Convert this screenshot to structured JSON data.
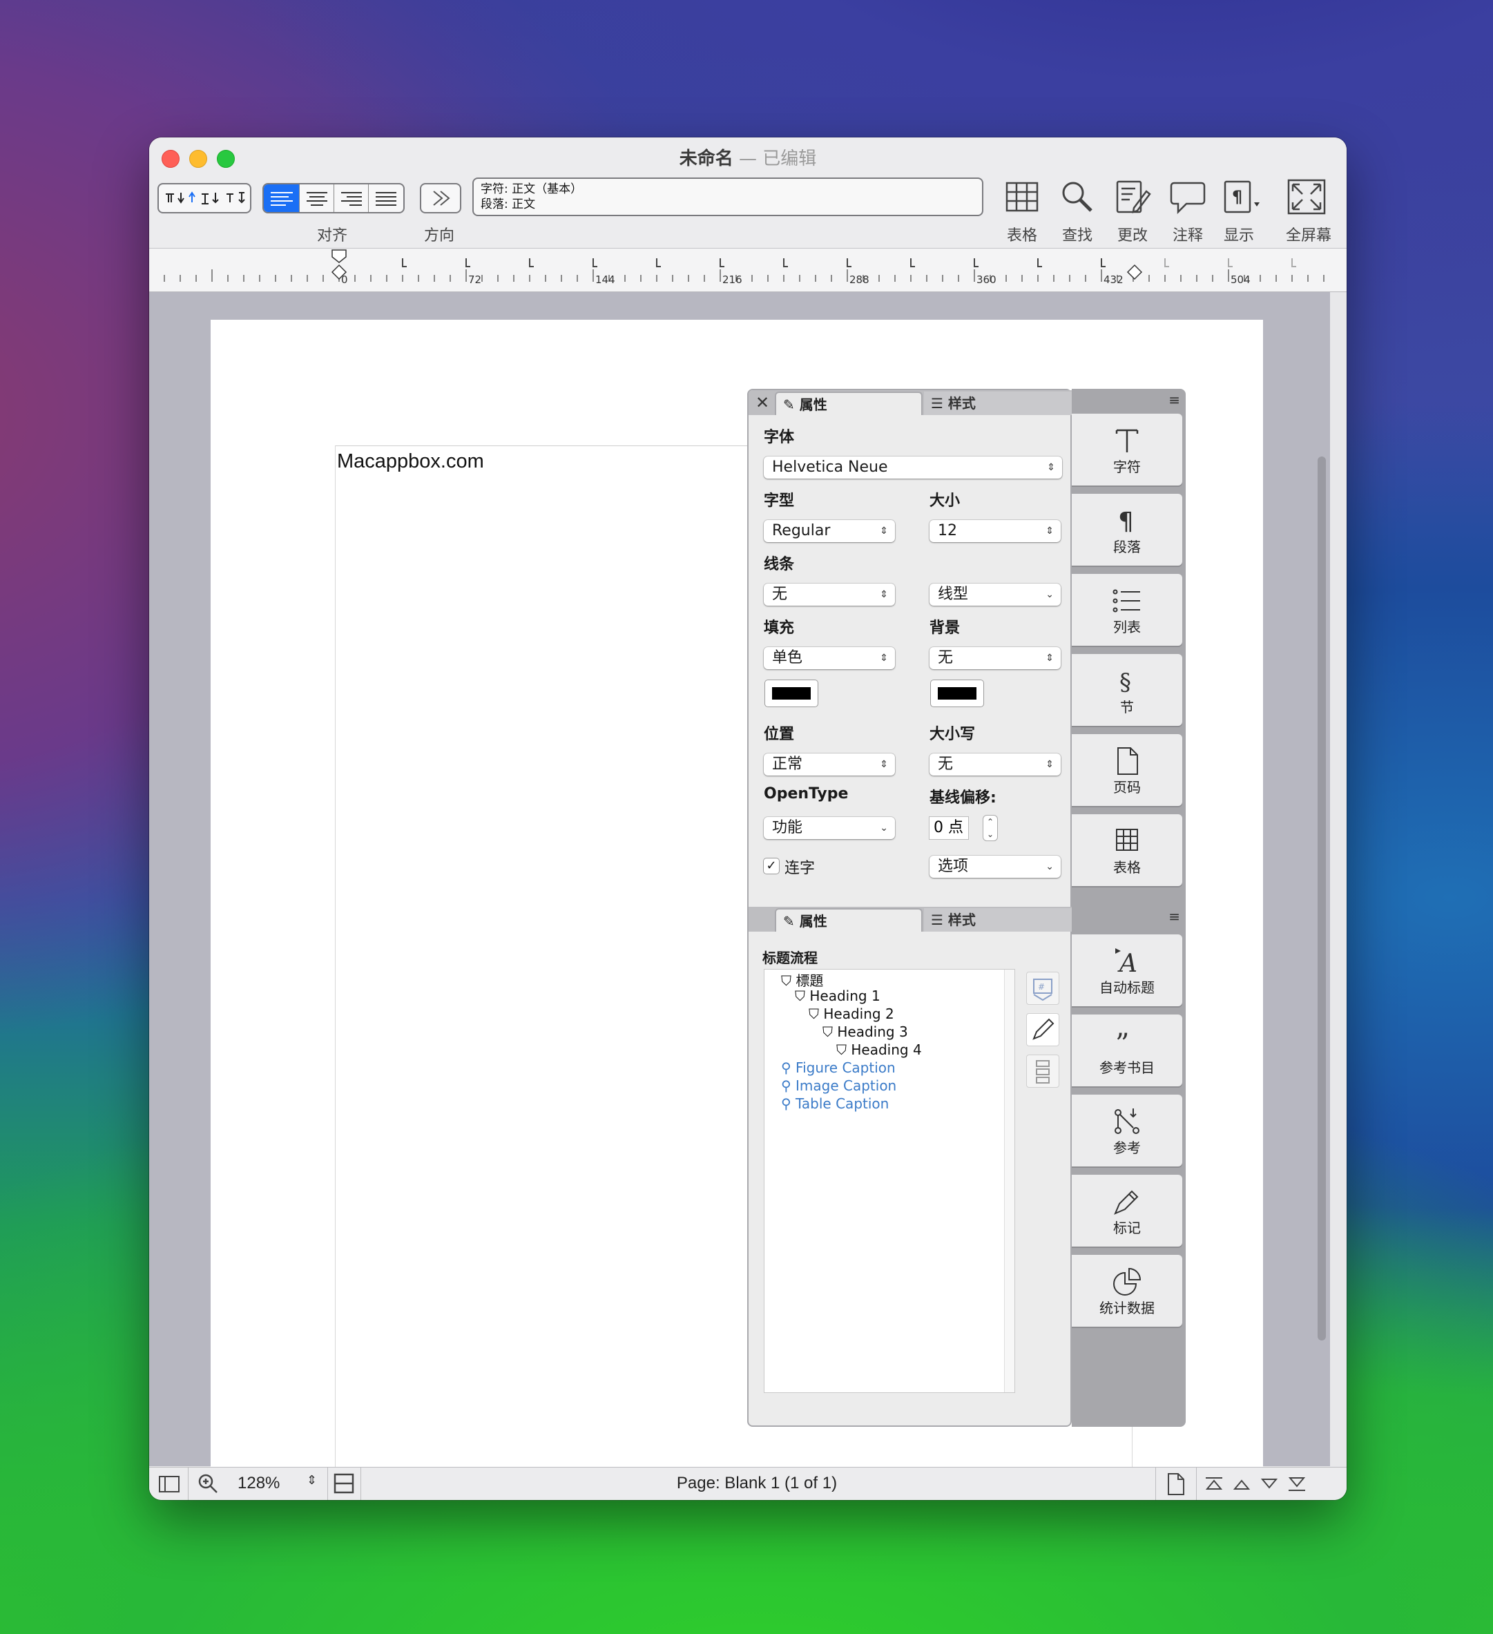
{
  "window": {
    "title": "未命名",
    "title_sep": " — ",
    "status": "已编辑"
  },
  "toolbar": {
    "align_label": "对齐",
    "direction_label": "方向",
    "style_info": {
      "char": "字符: 正文（基本）",
      "para": "段落: 正文"
    },
    "buttons": [
      {
        "label": "表格",
        "icon": "table-icon"
      },
      {
        "label": "查找",
        "icon": "magnifier-icon"
      },
      {
        "label": "更改",
        "icon": "track-changes-icon"
      },
      {
        "label": "注释",
        "icon": "comment-icon"
      },
      {
        "label": "显示",
        "icon": "pilcrow-icon"
      },
      {
        "label": "全屏幕",
        "icon": "fullscreen-icon"
      }
    ]
  },
  "ruler": {
    "marks": [
      "0",
      "72",
      "144",
      "216",
      "288",
      "360",
      "432",
      "504"
    ]
  },
  "document": {
    "text": "Macappbox.com"
  },
  "inspector_top": {
    "tabs": {
      "properties": "属性",
      "styles": "样式"
    },
    "font_label": "字体",
    "font_value": "Helvetica Neue",
    "typeface_label": "字型",
    "typeface_value": "Regular",
    "size_label": "大小",
    "size_value": "12",
    "strike_label": "线条",
    "strike_value": "无",
    "line_style_value": "线型",
    "fill_label": "填充",
    "fill_value": "单色",
    "background_label": "背景",
    "background_value": "无",
    "position_label": "位置",
    "position_value": "正常",
    "case_label": "大小写",
    "case_value": "无",
    "opentype_label": "OpenType",
    "opentype_value": "功能",
    "baseline_label": "基线偏移:",
    "baseline_value": "0 点",
    "ligature_label": "连字",
    "ligature_checked": true,
    "options_value": "选项",
    "side_buttons": [
      {
        "label": "字符",
        "icon": "character-icon"
      },
      {
        "label": "段落",
        "icon": "paragraph-icon"
      },
      {
        "label": "列表",
        "icon": "list-icon"
      },
      {
        "label": "节",
        "icon": "section-icon"
      },
      {
        "label": "页码",
        "icon": "page-number-icon"
      },
      {
        "label": "表格",
        "icon": "table-icon"
      }
    ]
  },
  "inspector_bottom": {
    "tabs": {
      "properties": "属性",
      "styles": "样式"
    },
    "flow_label": "标题流程",
    "tree": [
      {
        "label": "標題",
        "level": 0,
        "type": "heading"
      },
      {
        "label": "Heading 1",
        "level": 1,
        "type": "heading"
      },
      {
        "label": "Heading 2",
        "level": 2,
        "type": "heading"
      },
      {
        "label": "Heading 3",
        "level": 3,
        "type": "heading"
      },
      {
        "label": "Heading 4",
        "level": 4,
        "type": "heading"
      },
      {
        "label": "Figure Caption",
        "level": 0,
        "type": "caption"
      },
      {
        "label": "Image Caption",
        "level": 0,
        "type": "caption"
      },
      {
        "label": "Table Caption",
        "level": 0,
        "type": "caption"
      }
    ],
    "side_buttons": [
      {
        "label": "自动标题",
        "icon": "auto-heading-icon"
      },
      {
        "label": "参考书目",
        "icon": "bibliography-icon"
      },
      {
        "label": "参考",
        "icon": "reference-icon"
      },
      {
        "label": "标记",
        "icon": "marker-icon"
      },
      {
        "label": "统计数据",
        "icon": "statistics-icon"
      }
    ]
  },
  "statusbar": {
    "zoom": "128%",
    "page_info": "Page: Blank 1 (1 of 1)"
  },
  "colors": {
    "accent": "#1a6ff5",
    "caption_blue": "#3b7bc8"
  }
}
